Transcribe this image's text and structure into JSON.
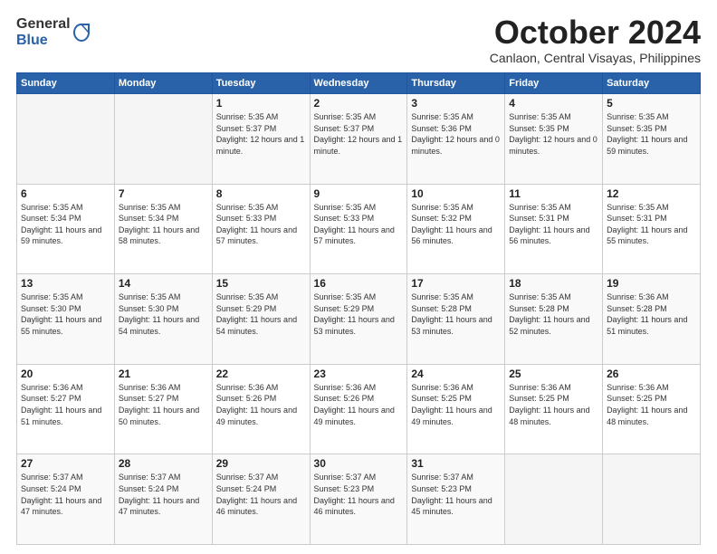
{
  "header": {
    "logo": {
      "general": "General",
      "blue": "Blue"
    },
    "month": "October 2024",
    "location": "Canlaon, Central Visayas, Philippines"
  },
  "weekdays": [
    "Sunday",
    "Monday",
    "Tuesday",
    "Wednesday",
    "Thursday",
    "Friday",
    "Saturday"
  ],
  "weeks": [
    [
      {
        "day": "",
        "sunrise": "",
        "sunset": "",
        "daylight": "",
        "empty": true
      },
      {
        "day": "",
        "sunrise": "",
        "sunset": "",
        "daylight": "",
        "empty": true
      },
      {
        "day": "1",
        "sunrise": "Sunrise: 5:35 AM",
        "sunset": "Sunset: 5:37 PM",
        "daylight": "Daylight: 12 hours and 1 minute.",
        "empty": false
      },
      {
        "day": "2",
        "sunrise": "Sunrise: 5:35 AM",
        "sunset": "Sunset: 5:37 PM",
        "daylight": "Daylight: 12 hours and 1 minute.",
        "empty": false
      },
      {
        "day": "3",
        "sunrise": "Sunrise: 5:35 AM",
        "sunset": "Sunset: 5:36 PM",
        "daylight": "Daylight: 12 hours and 0 minutes.",
        "empty": false
      },
      {
        "day": "4",
        "sunrise": "Sunrise: 5:35 AM",
        "sunset": "Sunset: 5:35 PM",
        "daylight": "Daylight: 12 hours and 0 minutes.",
        "empty": false
      },
      {
        "day": "5",
        "sunrise": "Sunrise: 5:35 AM",
        "sunset": "Sunset: 5:35 PM",
        "daylight": "Daylight: 11 hours and 59 minutes.",
        "empty": false
      }
    ],
    [
      {
        "day": "6",
        "sunrise": "Sunrise: 5:35 AM",
        "sunset": "Sunset: 5:34 PM",
        "daylight": "Daylight: 11 hours and 59 minutes.",
        "empty": false
      },
      {
        "day": "7",
        "sunrise": "Sunrise: 5:35 AM",
        "sunset": "Sunset: 5:34 PM",
        "daylight": "Daylight: 11 hours and 58 minutes.",
        "empty": false
      },
      {
        "day": "8",
        "sunrise": "Sunrise: 5:35 AM",
        "sunset": "Sunset: 5:33 PM",
        "daylight": "Daylight: 11 hours and 57 minutes.",
        "empty": false
      },
      {
        "day": "9",
        "sunrise": "Sunrise: 5:35 AM",
        "sunset": "Sunset: 5:33 PM",
        "daylight": "Daylight: 11 hours and 57 minutes.",
        "empty": false
      },
      {
        "day": "10",
        "sunrise": "Sunrise: 5:35 AM",
        "sunset": "Sunset: 5:32 PM",
        "daylight": "Daylight: 11 hours and 56 minutes.",
        "empty": false
      },
      {
        "day": "11",
        "sunrise": "Sunrise: 5:35 AM",
        "sunset": "Sunset: 5:31 PM",
        "daylight": "Daylight: 11 hours and 56 minutes.",
        "empty": false
      },
      {
        "day": "12",
        "sunrise": "Sunrise: 5:35 AM",
        "sunset": "Sunset: 5:31 PM",
        "daylight": "Daylight: 11 hours and 55 minutes.",
        "empty": false
      }
    ],
    [
      {
        "day": "13",
        "sunrise": "Sunrise: 5:35 AM",
        "sunset": "Sunset: 5:30 PM",
        "daylight": "Daylight: 11 hours and 55 minutes.",
        "empty": false
      },
      {
        "day": "14",
        "sunrise": "Sunrise: 5:35 AM",
        "sunset": "Sunset: 5:30 PM",
        "daylight": "Daylight: 11 hours and 54 minutes.",
        "empty": false
      },
      {
        "day": "15",
        "sunrise": "Sunrise: 5:35 AM",
        "sunset": "Sunset: 5:29 PM",
        "daylight": "Daylight: 11 hours and 54 minutes.",
        "empty": false
      },
      {
        "day": "16",
        "sunrise": "Sunrise: 5:35 AM",
        "sunset": "Sunset: 5:29 PM",
        "daylight": "Daylight: 11 hours and 53 minutes.",
        "empty": false
      },
      {
        "day": "17",
        "sunrise": "Sunrise: 5:35 AM",
        "sunset": "Sunset: 5:28 PM",
        "daylight": "Daylight: 11 hours and 53 minutes.",
        "empty": false
      },
      {
        "day": "18",
        "sunrise": "Sunrise: 5:35 AM",
        "sunset": "Sunset: 5:28 PM",
        "daylight": "Daylight: 11 hours and 52 minutes.",
        "empty": false
      },
      {
        "day": "19",
        "sunrise": "Sunrise: 5:36 AM",
        "sunset": "Sunset: 5:28 PM",
        "daylight": "Daylight: 11 hours and 51 minutes.",
        "empty": false
      }
    ],
    [
      {
        "day": "20",
        "sunrise": "Sunrise: 5:36 AM",
        "sunset": "Sunset: 5:27 PM",
        "daylight": "Daylight: 11 hours and 51 minutes.",
        "empty": false
      },
      {
        "day": "21",
        "sunrise": "Sunrise: 5:36 AM",
        "sunset": "Sunset: 5:27 PM",
        "daylight": "Daylight: 11 hours and 50 minutes.",
        "empty": false
      },
      {
        "day": "22",
        "sunrise": "Sunrise: 5:36 AM",
        "sunset": "Sunset: 5:26 PM",
        "daylight": "Daylight: 11 hours and 49 minutes.",
        "empty": false
      },
      {
        "day": "23",
        "sunrise": "Sunrise: 5:36 AM",
        "sunset": "Sunset: 5:26 PM",
        "daylight": "Daylight: 11 hours and 49 minutes.",
        "empty": false
      },
      {
        "day": "24",
        "sunrise": "Sunrise: 5:36 AM",
        "sunset": "Sunset: 5:25 PM",
        "daylight": "Daylight: 11 hours and 49 minutes.",
        "empty": false
      },
      {
        "day": "25",
        "sunrise": "Sunrise: 5:36 AM",
        "sunset": "Sunset: 5:25 PM",
        "daylight": "Daylight: 11 hours and 48 minutes.",
        "empty": false
      },
      {
        "day": "26",
        "sunrise": "Sunrise: 5:36 AM",
        "sunset": "Sunset: 5:25 PM",
        "daylight": "Daylight: 11 hours and 48 minutes.",
        "empty": false
      }
    ],
    [
      {
        "day": "27",
        "sunrise": "Sunrise: 5:37 AM",
        "sunset": "Sunset: 5:24 PM",
        "daylight": "Daylight: 11 hours and 47 minutes.",
        "empty": false
      },
      {
        "day": "28",
        "sunrise": "Sunrise: 5:37 AM",
        "sunset": "Sunset: 5:24 PM",
        "daylight": "Daylight: 11 hours and 47 minutes.",
        "empty": false
      },
      {
        "day": "29",
        "sunrise": "Sunrise: 5:37 AM",
        "sunset": "Sunset: 5:24 PM",
        "daylight": "Daylight: 11 hours and 46 minutes.",
        "empty": false
      },
      {
        "day": "30",
        "sunrise": "Sunrise: 5:37 AM",
        "sunset": "Sunset: 5:23 PM",
        "daylight": "Daylight: 11 hours and 46 minutes.",
        "empty": false
      },
      {
        "day": "31",
        "sunrise": "Sunrise: 5:37 AM",
        "sunset": "Sunset: 5:23 PM",
        "daylight": "Daylight: 11 hours and 45 minutes.",
        "empty": false
      },
      {
        "day": "",
        "sunrise": "",
        "sunset": "",
        "daylight": "",
        "empty": true
      },
      {
        "day": "",
        "sunrise": "",
        "sunset": "",
        "daylight": "",
        "empty": true
      }
    ]
  ]
}
